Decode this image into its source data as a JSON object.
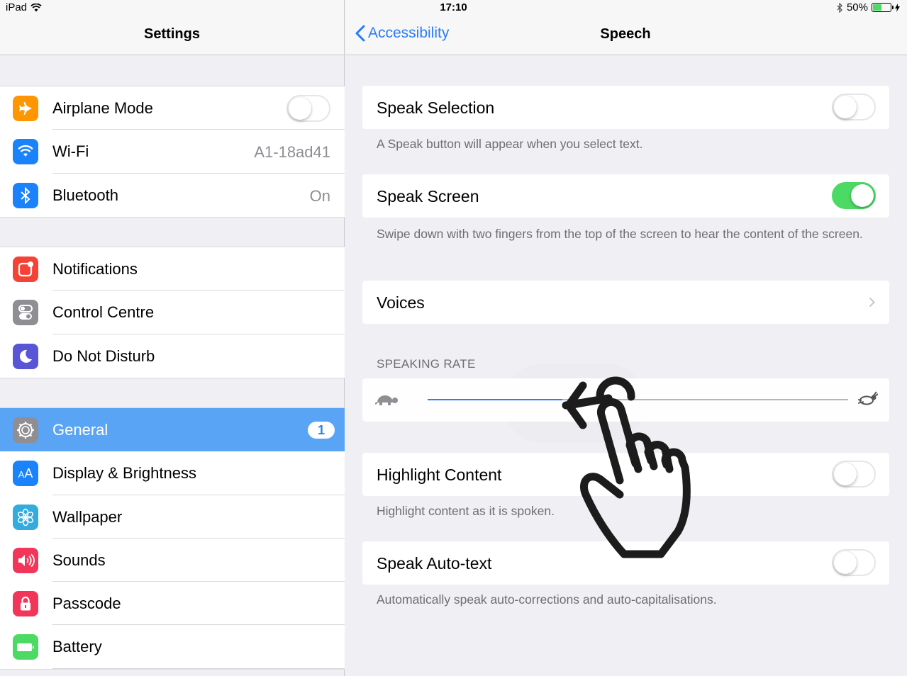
{
  "status": {
    "device": "iPad",
    "time": "17:10",
    "battery_pct": "50%",
    "battery_level": 0.5
  },
  "settings_pane": {
    "title": "Settings",
    "groups": [
      [
        {
          "label": "Airplane Mode",
          "icon": "airplane-icon",
          "color": "#ff9500",
          "toggle": false
        },
        {
          "label": "Wi-Fi",
          "icon": "wifi-icon",
          "color": "#1a82fb",
          "value": "A1-18ad41"
        },
        {
          "label": "Bluetooth",
          "icon": "bluetooth-icon",
          "color": "#1a82fb",
          "value": "On"
        }
      ],
      [
        {
          "label": "Notifications",
          "icon": "notifications-icon",
          "color": "#f44336"
        },
        {
          "label": "Control Centre",
          "icon": "control-centre-icon",
          "color": "#8e8e93"
        },
        {
          "label": "Do Not Disturb",
          "icon": "moon-icon",
          "color": "#5856d6"
        }
      ],
      [
        {
          "label": "General",
          "icon": "gear-icon",
          "color": "#8e8e93",
          "badge": "1",
          "selected": true
        },
        {
          "label": "Display & Brightness",
          "icon": "display-icon",
          "color": "#1a82fb"
        },
        {
          "label": "Wallpaper",
          "icon": "wallpaper-icon",
          "color": "#35aadc"
        },
        {
          "label": "Sounds",
          "icon": "speaker-icon",
          "color": "#f2365a"
        },
        {
          "label": "Passcode",
          "icon": "lock-icon",
          "color": "#f2365a"
        },
        {
          "label": "Battery",
          "icon": "battery-icon",
          "color": "#4cd964"
        }
      ]
    ]
  },
  "speech_pane": {
    "back_label": "Accessibility",
    "title": "Speech",
    "speak_selection": {
      "label": "Speak Selection",
      "on": false,
      "footer": "A Speak button will appear when you select text."
    },
    "speak_screen": {
      "label": "Speak Screen",
      "on": true,
      "footer": "Swipe down with two fingers from the top of the screen to hear the content of the screen."
    },
    "voices": {
      "label": "Voices"
    },
    "speaking_rate": {
      "header": "SPEAKING RATE",
      "value": 0.32
    },
    "highlight_content": {
      "label": "Highlight Content",
      "on": false,
      "footer": "Highlight content as it is spoken."
    },
    "speak_auto_text": {
      "label": "Speak Auto-text",
      "on": false,
      "footer": "Automatically speak auto-corrections and auto-capitalisations."
    }
  }
}
